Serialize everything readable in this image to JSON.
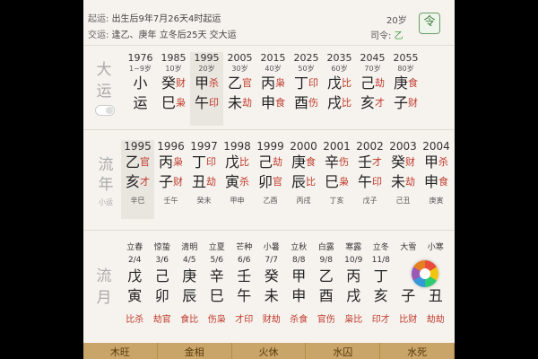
{
  "header": {
    "qiyun_label": "起运:",
    "qiyun_text": "出生后9年7月26天4时起运",
    "qiyun_age": "20岁",
    "jiaoyun_label": "交运:",
    "jiaoyun_text": "逢乙、庚年 立冬后25天 交大运",
    "siling_label": "司令:",
    "siling_value": "乙",
    "ling_icon": "令"
  },
  "dayun": {
    "label": [
      "大",
      "运"
    ],
    "first": {
      "years": "1976",
      "ages": "1~9岁",
      "chars": [
        "小",
        "运"
      ]
    },
    "columns": [
      {
        "year": "1985",
        "age": "10岁",
        "stem": "癸",
        "stem_rel": "财",
        "branch": "巳",
        "branch_rel": "枭"
      },
      {
        "year": "1995",
        "age": "20岁",
        "stem": "甲",
        "stem_rel": "杀",
        "branch": "午",
        "branch_rel": "印",
        "selected": true
      },
      {
        "year": "2005",
        "age": "30岁",
        "stem": "乙",
        "stem_rel": "官",
        "branch": "未",
        "branch_rel": "劫"
      },
      {
        "year": "2015",
        "age": "40岁",
        "stem": "丙",
        "stem_rel": "枭",
        "branch": "申",
        "branch_rel": "食"
      },
      {
        "year": "2025",
        "age": "50岁",
        "stem": "丁",
        "stem_rel": "印",
        "branch": "酉",
        "branch_rel": "伤"
      },
      {
        "year": "2035",
        "age": "60岁",
        "stem": "戊",
        "stem_rel": "比",
        "branch": "戌",
        "branch_rel": "比"
      },
      {
        "year": "2045",
        "age": "70岁",
        "stem": "己",
        "stem_rel": "劫",
        "branch": "亥",
        "branch_rel": "才"
      },
      {
        "year": "2055",
        "age": "80岁",
        "stem": "庚",
        "stem_rel": "食",
        "branch": "子",
        "branch_rel": "财"
      }
    ]
  },
  "liunian": {
    "label": [
      "流",
      "年"
    ],
    "sub": "小运",
    "columns": [
      {
        "year": "1995",
        "stem": "乙",
        "stem_rel": "官",
        "branch": "亥",
        "branch_rel": "才",
        "xiaoyun": "辛巳",
        "selected": true
      },
      {
        "year": "1996",
        "stem": "丙",
        "stem_rel": "枭",
        "branch": "子",
        "branch_rel": "财",
        "xiaoyun": "壬午"
      },
      {
        "year": "1997",
        "stem": "丁",
        "stem_rel": "印",
        "branch": "丑",
        "branch_rel": "劫",
        "xiaoyun": "癸未"
      },
      {
        "year": "1998",
        "stem": "戊",
        "stem_rel": "比",
        "branch": "寅",
        "branch_rel": "杀",
        "xiaoyun": "甲申"
      },
      {
        "year": "1999",
        "stem": "己",
        "stem_rel": "劫",
        "branch": "卯",
        "branch_rel": "官",
        "xiaoyun": "乙酉"
      },
      {
        "year": "2000",
        "stem": "庚",
        "stem_rel": "食",
        "branch": "辰",
        "branch_rel": "比",
        "xiaoyun": "丙戌"
      },
      {
        "year": "2001",
        "stem": "辛",
        "stem_rel": "伤",
        "branch": "巳",
        "branch_rel": "枭",
        "xiaoyun": "丁亥"
      },
      {
        "year": "2002",
        "stem": "壬",
        "stem_rel": "才",
        "branch": "午",
        "branch_rel": "印",
        "xiaoyun": "戊子"
      },
      {
        "year": "2003",
        "stem": "癸",
        "stem_rel": "财",
        "branch": "未",
        "branch_rel": "劫",
        "xiaoyun": "己丑"
      },
      {
        "year": "2004",
        "stem": "甲",
        "stem_rel": "杀",
        "branch": "申",
        "branch_rel": "食",
        "xiaoyun": "庚寅"
      }
    ]
  },
  "liuyue": {
    "label": [
      "流",
      "月"
    ],
    "columns": [
      {
        "term": "立春",
        "date": "2/4",
        "stem": "戊",
        "branch": "寅",
        "rel": "比杀"
      },
      {
        "term": "惊蛰",
        "date": "3/6",
        "stem": "己",
        "branch": "卯",
        "rel": "劫官"
      },
      {
        "term": "清明",
        "date": "4/5",
        "stem": "庚",
        "branch": "辰",
        "rel": "食比"
      },
      {
        "term": "立夏",
        "date": "5/6",
        "stem": "辛",
        "branch": "巳",
        "rel": "伤枭"
      },
      {
        "term": "芒种",
        "date": "6/6",
        "stem": "壬",
        "branch": "午",
        "rel": "才印"
      },
      {
        "term": "小暑",
        "date": "7/7",
        "stem": "癸",
        "branch": "未",
        "rel": "财劫"
      },
      {
        "term": "立秋",
        "date": "8/8",
        "stem": "甲",
        "branch": "申",
        "rel": "杀食"
      },
      {
        "term": "白露",
        "date": "9/8",
        "stem": "乙",
        "branch": "酉",
        "rel": "官伤"
      },
      {
        "term": "寒露",
        "date": "10/9",
        "stem": "丙",
        "branch": "戌",
        "rel": "枭比"
      },
      {
        "term": "立冬",
        "date": "11/8",
        "stem": "丁",
        "branch": "亥",
        "rel": "印才"
      },
      {
        "term": "大雪",
        "date": "",
        "stem": "",
        "branch": "子",
        "rel": "比财"
      },
      {
        "term": "小寒",
        "date": "",
        "stem": "",
        "branch": "丑",
        "rel": "劫劫"
      }
    ]
  },
  "bottom_tabs": [
    "木旺",
    "金相",
    "火休",
    "水囚",
    "水死"
  ],
  "colors": {
    "accent_red": "#c0392b",
    "gold": "#c9a569",
    "green": "#3b7a3b"
  }
}
